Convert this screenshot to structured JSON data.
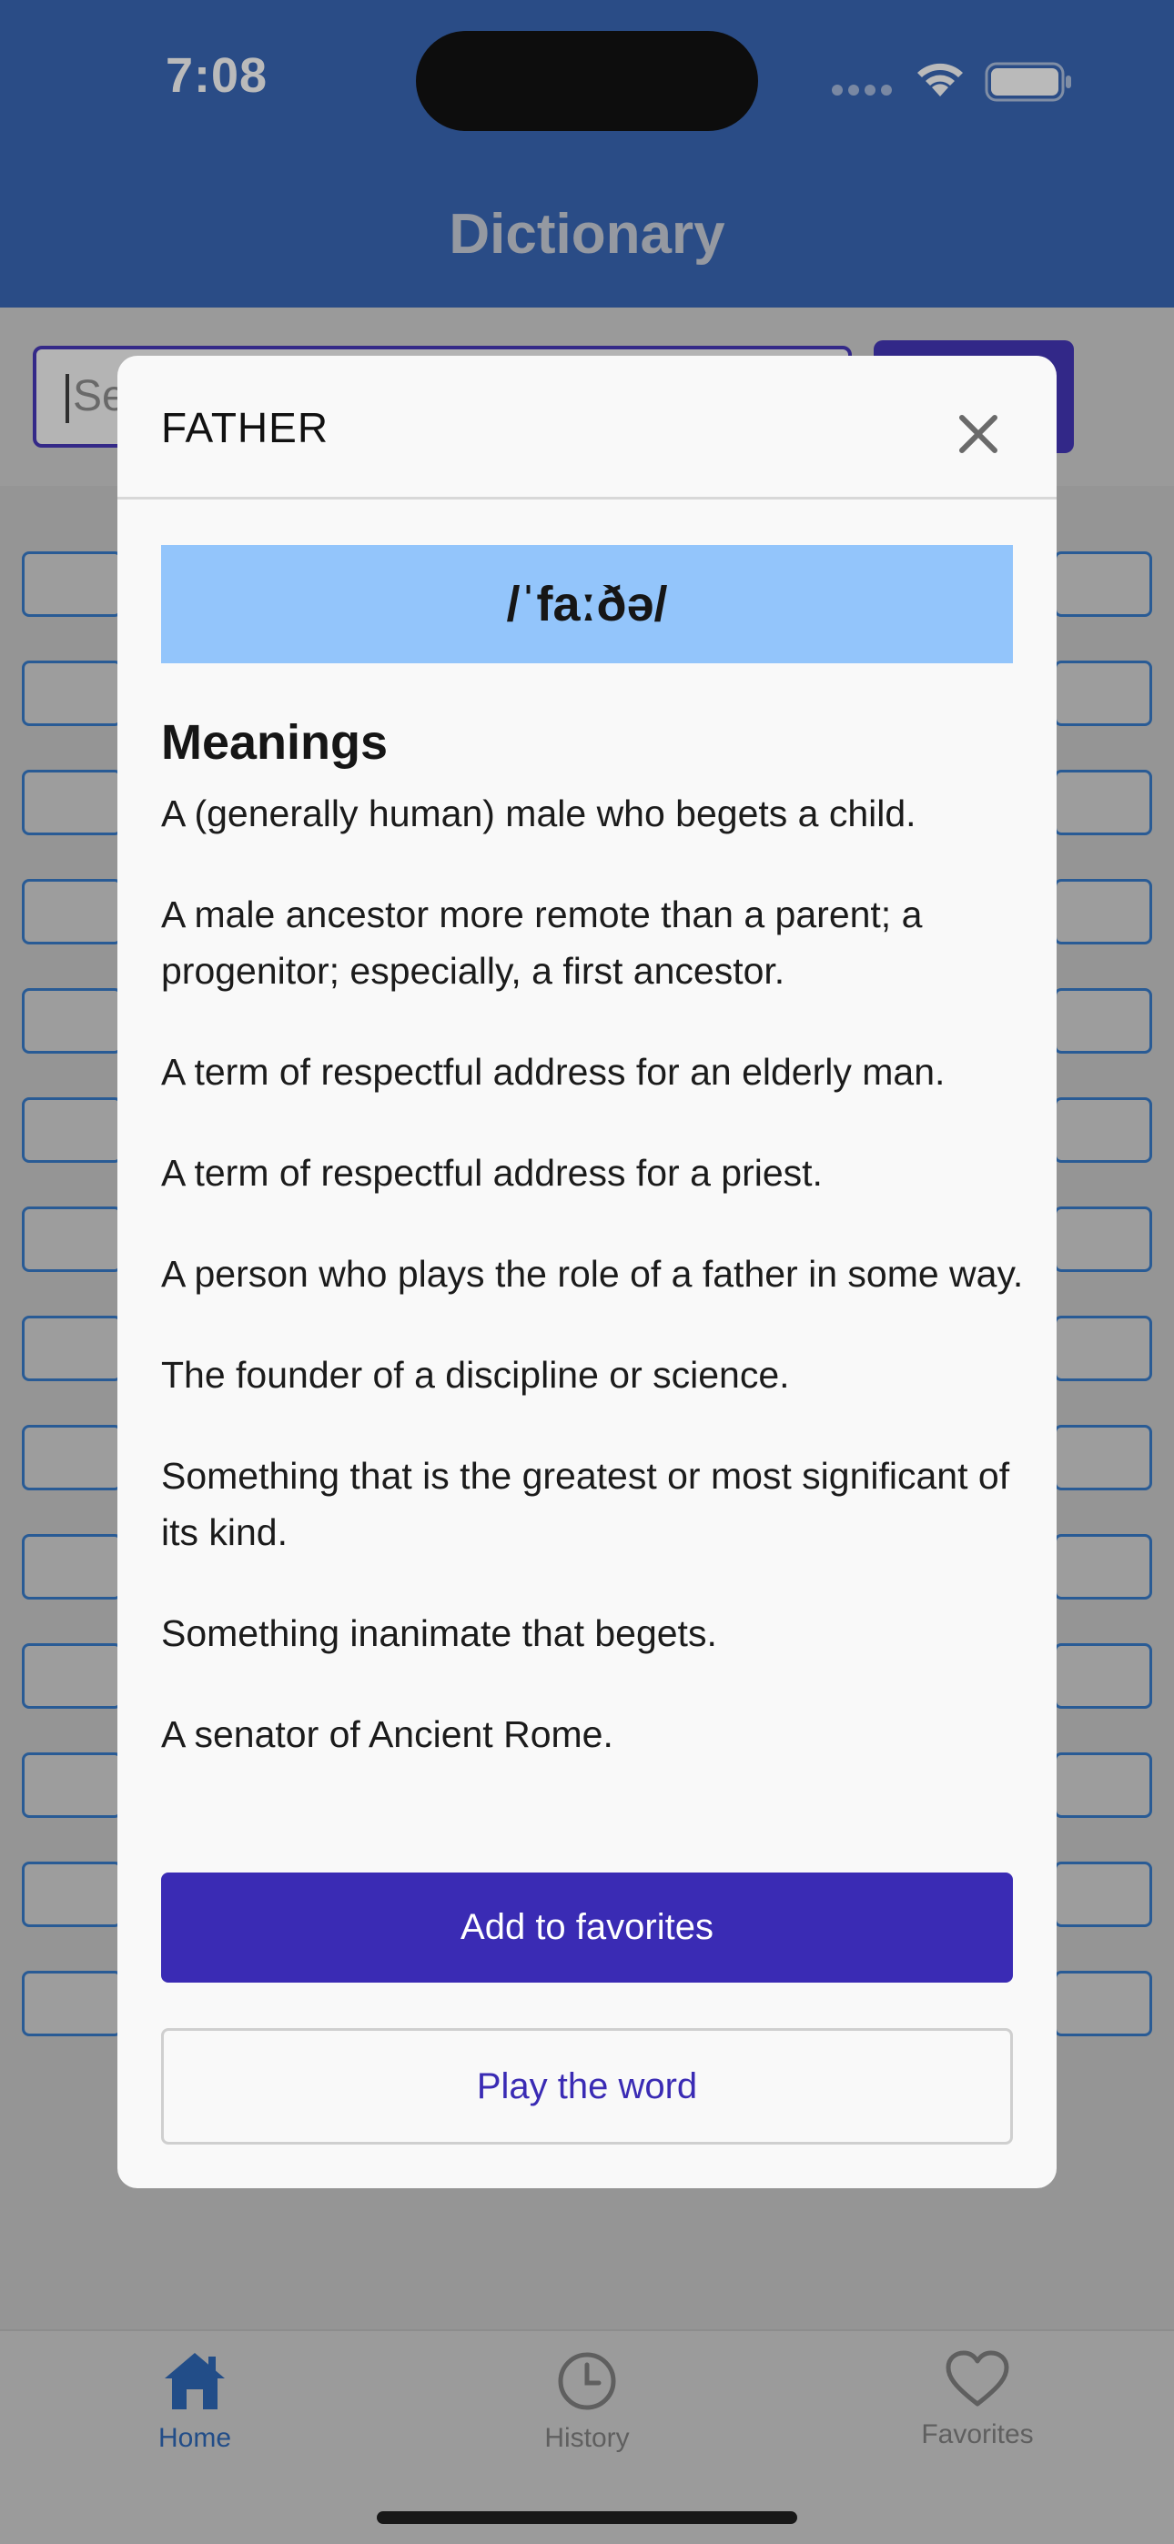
{
  "status_bar": {
    "time": "7:08"
  },
  "header": {
    "title": "Dictionary"
  },
  "search": {
    "placeholder": "Se"
  },
  "modal": {
    "word": "FATHER",
    "phonetic": "/ˈfaːðə/",
    "meanings_title": "Meanings",
    "meanings": [
      "A (generally human) male who begets a child.",
      "A male ancestor more remote than a parent; a progenitor; especially, a first ancestor.",
      "A term of respectful address for an elderly man.",
      "A term of respectful address for a priest.",
      "A person who plays the role of a father in some way.",
      "The founder of a discipline or science.",
      "Something that is the greatest or most significant of its kind.",
      "Something inanimate that begets.",
      "A senator of Ancient Rome."
    ],
    "add_favorites_label": "Add to favorites",
    "play_label": "Play the word"
  },
  "tabs": [
    {
      "label": "Home",
      "icon": "house-icon",
      "active": true
    },
    {
      "label": "History",
      "icon": "clock-icon",
      "active": false
    },
    {
      "label": "Favorites",
      "icon": "heart-icon",
      "active": false
    }
  ],
  "colors": {
    "header_bg": "#2b5db3",
    "accent": "#3a2bb4",
    "phonetic_bg": "#93c5fb",
    "tab_active": "#1f5fb5"
  }
}
